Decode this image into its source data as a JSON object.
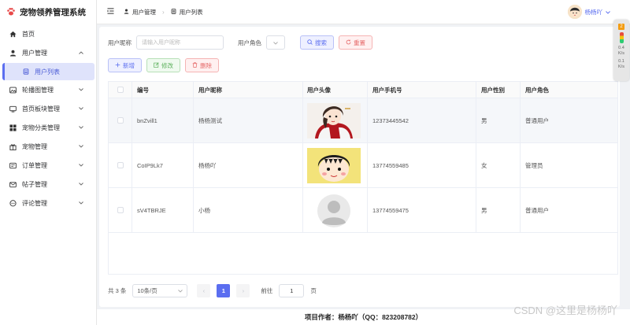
{
  "app": {
    "title": "宠物领养管理系统",
    "brand_color": "#e84a4a"
  },
  "sidebar": {
    "items": [
      {
        "label": "首页",
        "icon": "home-icon",
        "expandable": false
      },
      {
        "label": "用户管理",
        "icon": "user-icon",
        "expandable": true,
        "expanded": true
      },
      {
        "label": "用户列表",
        "icon": "list-icon",
        "sub": true,
        "active": true
      },
      {
        "label": "轮播图管理",
        "icon": "image-icon",
        "expandable": true
      },
      {
        "label": "首页板块管理",
        "icon": "board-icon",
        "expandable": true
      },
      {
        "label": "宠物分类管理",
        "icon": "grid-icon",
        "expandable": true
      },
      {
        "label": "宠物管理",
        "icon": "gift-icon",
        "expandable": true
      },
      {
        "label": "订单管理",
        "icon": "order-icon",
        "expandable": true
      },
      {
        "label": "帖子管理",
        "icon": "mail-icon",
        "expandable": true
      },
      {
        "label": "评论管理",
        "icon": "comment-icon",
        "expandable": true
      }
    ]
  },
  "header": {
    "breadcrumb": [
      {
        "label": "用户管理",
        "icon": "user-icon"
      },
      {
        "label": "用户列表",
        "icon": "list-icon"
      }
    ],
    "username": "杨杨吖"
  },
  "search": {
    "nickname_label": "用户昵称",
    "nickname_placeholder": "请输入用户昵称",
    "role_label": "用户角色",
    "search_btn": "搜索",
    "reset_btn": "重置"
  },
  "actions": {
    "add": "新增",
    "edit": "修改",
    "delete": "删除"
  },
  "table": {
    "columns": [
      "",
      "编号",
      "用户昵称",
      "用户头像",
      "用户手机号",
      "用户性别",
      "用户角色"
    ],
    "rows": [
      {
        "id": "bnZvill1",
        "nickname": "杨杨测试",
        "avatar": "anime-girl",
        "phone": "12373445542",
        "gender": "男",
        "role": "普通用户"
      },
      {
        "id": "CoIP9Lk7",
        "nickname": "杨杨吖",
        "avatar": "cartoon-girl",
        "phone": "13774559485",
        "gender": "女",
        "role": "管理员"
      },
      {
        "id": "sV4TBRJE",
        "nickname": "小杨",
        "avatar": "default-avatar",
        "phone": "13774559475",
        "gender": "男",
        "role": "普通用户"
      }
    ]
  },
  "pagination": {
    "total": "共 3 条",
    "page_size": "10条/页",
    "current": "1",
    "goto_label": "前往",
    "goto_value": "1",
    "page_unit": "页"
  },
  "footer": {
    "text": "项目作者：杨杨吖（QQ：823208782）"
  },
  "watermark": "CSDN @这里是杨杨吖",
  "widget": {
    "badge": "2",
    "lines": [
      "0.4",
      "K/s",
      "0.1",
      "K/s"
    ]
  },
  "colors": {
    "primary": "#5b6ef0",
    "success": "#5fb25f",
    "danger": "#e56767"
  }
}
